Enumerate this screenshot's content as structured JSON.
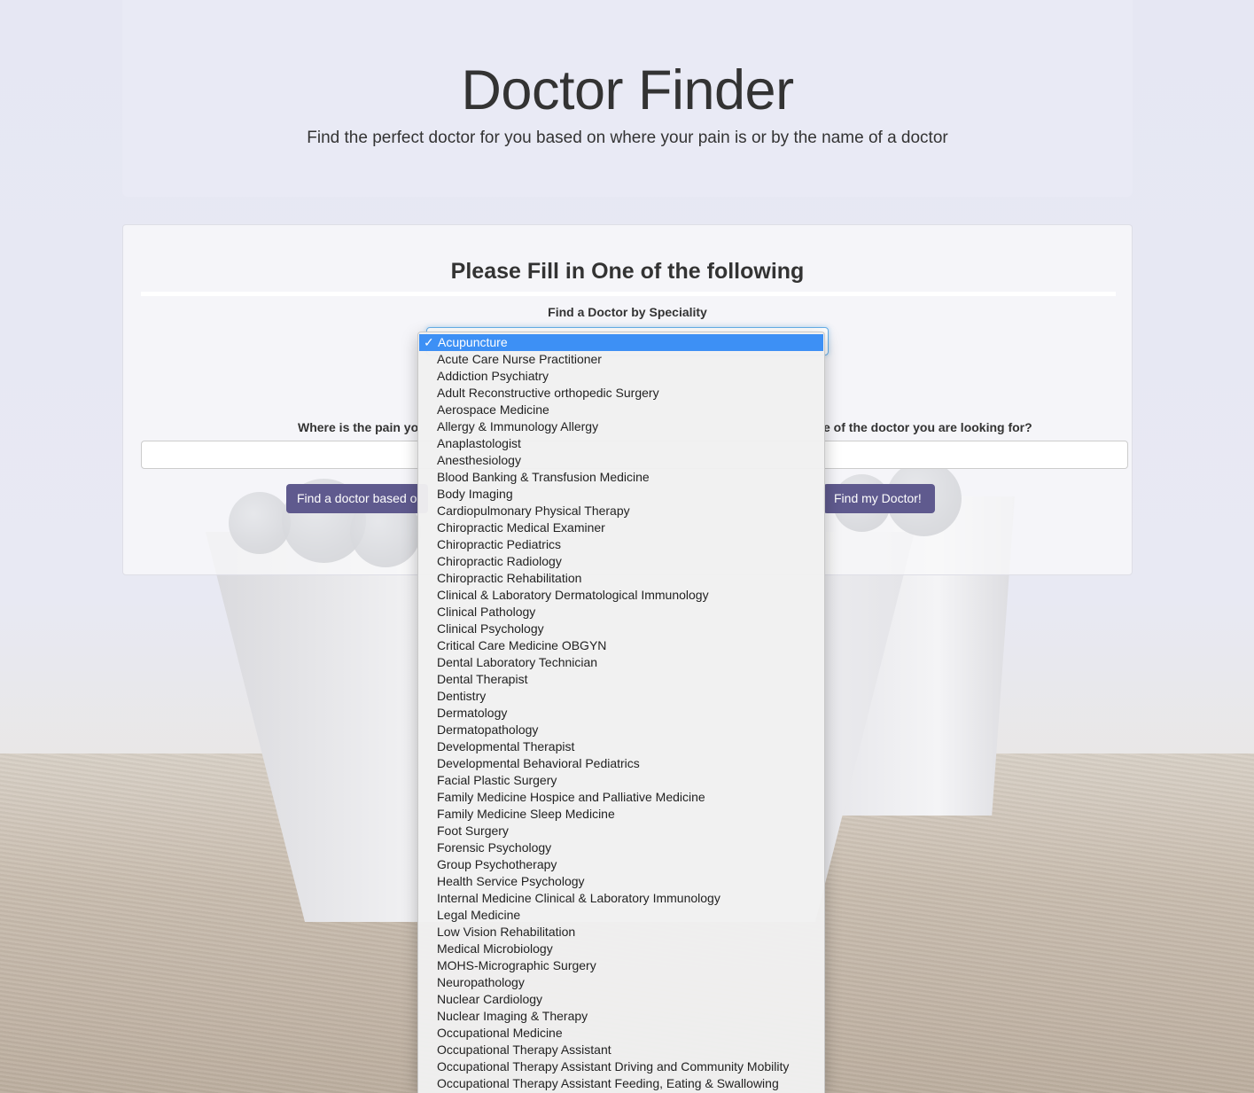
{
  "header": {
    "title": "Doctor Finder",
    "subtitle": "Find the perfect doctor for you based on where your pain is or by the name of a doctor"
  },
  "form": {
    "heading": "Please Fill in One of the following",
    "speciality_label": "Find a Doctor by Speciality",
    "pain_label": "Where is the pain yo",
    "name_label": "e of the doctor you are looking for?",
    "left_button": "Find a doctor based o",
    "right_button": "Find my Doctor!"
  },
  "dropdown": {
    "selected_check": "✓",
    "options": [
      "Acupuncture",
      "Acute Care Nurse Practitioner",
      "Addiction Psychiatry",
      "Adult Reconstructive orthopedic Surgery",
      "Aerospace Medicine",
      "Allergy & Immunology Allergy",
      "Anaplastologist",
      "Anesthesiology",
      "Blood Banking & Transfusion Medicine",
      "Body Imaging",
      "Cardiopulmonary Physical Therapy",
      "Chiropractic Medical Examiner",
      "Chiropractic Pediatrics",
      "Chiropractic Radiology",
      "Chiropractic Rehabilitation",
      "Clinical & Laboratory Dermatological Immunology",
      "Clinical Pathology",
      "Clinical Psychology",
      "Critical Care Medicine OBGYN",
      "Dental Laboratory Technician",
      "Dental Therapist",
      "Dentistry",
      "Dermatology",
      "Dermatopathology",
      "Developmental Therapist",
      "Developmental Behavioral Pediatrics",
      "Facial Plastic Surgery",
      "Family Medicine Hospice and Palliative Medicine",
      "Family Medicine Sleep Medicine",
      "Foot Surgery",
      "Forensic Psychology",
      "Group Psychotherapy",
      "Health Service Psychology",
      "Internal Medicine Clinical & Laboratory Immunology",
      "Legal Medicine",
      "Low Vision Rehabilitation",
      "Medical Microbiology",
      "MOHS-Micrographic Surgery",
      "Neuropathology",
      "Nuclear Cardiology",
      "Nuclear Imaging & Therapy",
      "Occupational Medicine",
      "Occupational Therapy Assistant",
      "Occupational Therapy Assistant Driving and Community Mobility",
      "Occupational Therapy Assistant Feeding, Eating & Swallowing"
    ]
  }
}
